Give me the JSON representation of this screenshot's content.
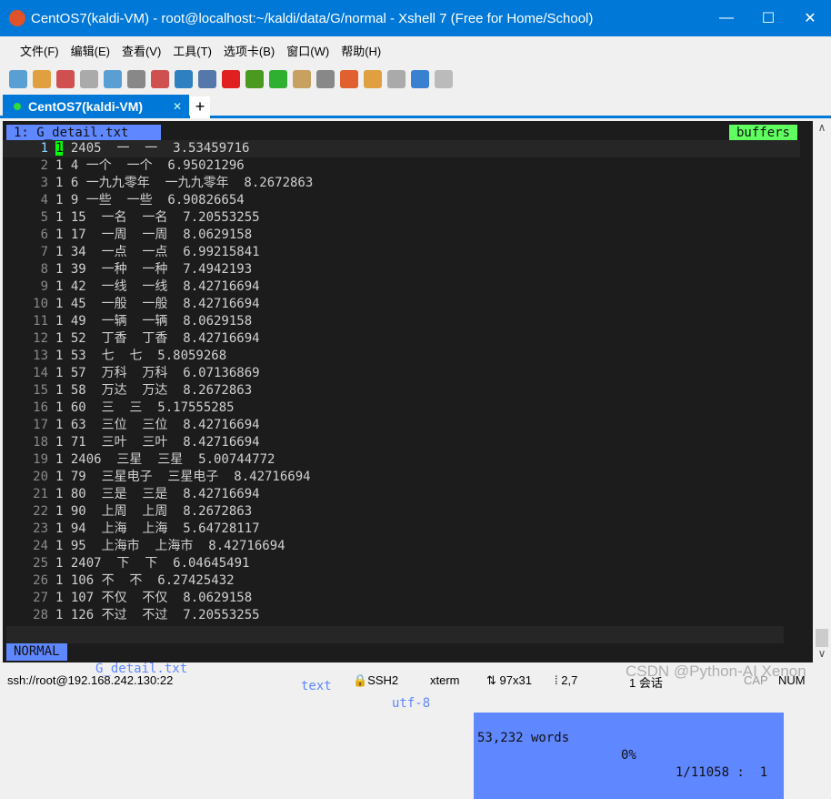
{
  "window": {
    "title": "CentOS7(kaldi-VM) - root@localhost:~/kaldi/data/G/normal - Xshell 7 (Free for Home/School)"
  },
  "menu": [
    "文件(F)",
    "编辑(E)",
    "查看(V)",
    "工具(T)",
    "选项卡(B)",
    "窗口(W)",
    "帮助(H)"
  ],
  "toolbar": [
    "new-session-icon",
    "open-icon",
    "disconnect-icon",
    "reconnect-icon",
    "properties-icon",
    "find-icon",
    "transfer-icon",
    "globe-icon",
    "font-icon",
    "xshell-icon",
    "xftp-icon",
    "fullscreen-icon",
    "lock-icon",
    "keyboard-icon",
    "highlight-icon",
    "new-folder-icon",
    "layout-icon",
    "help-icon",
    "chat-icon"
  ],
  "tab": {
    "label": "CentOS7(kaldi-VM)",
    "add": "+"
  },
  "vim": {
    "buffer": "1: G_detail.txt",
    "buffers": "buffers",
    "lines": [
      [
        "1",
        "1 2405  一  一  3.53459716"
      ],
      [
        "2",
        "1 4 一个  一个  6.95021296"
      ],
      [
        "3",
        "1 6 一九九零年  一九九零年  8.2672863"
      ],
      [
        "4",
        "1 9 一些  一些  6.90826654"
      ],
      [
        "5",
        "1 15  一名  一名  7.20553255"
      ],
      [
        "6",
        "1 17  一周  一周  8.0629158"
      ],
      [
        "7",
        "1 34  一点  一点  6.99215841"
      ],
      [
        "8",
        "1 39  一种  一种  7.4942193"
      ],
      [
        "9",
        "1 42  一线  一线  8.42716694"
      ],
      [
        "10",
        "1 45  一般  一般  8.42716694"
      ],
      [
        "11",
        "1 49  一辆  一辆  8.0629158"
      ],
      [
        "12",
        "1 52  丁香  丁香  8.42716694"
      ],
      [
        "13",
        "1 53  七  七  5.8059268"
      ],
      [
        "14",
        "1 57  万科  万科  6.07136869"
      ],
      [
        "15",
        "1 58  万达  万达  8.2672863"
      ],
      [
        "16",
        "1 60  三  三  5.17555285"
      ],
      [
        "17",
        "1 63  三位  三位  8.42716694"
      ],
      [
        "18",
        "1 71  三叶  三叶  8.42716694"
      ],
      [
        "19",
        "1 2406  三星  三星  5.00744772"
      ],
      [
        "20",
        "1 79  三星电子  三星电子  8.42716694"
      ],
      [
        "21",
        "1 80  三是  三是  8.42716694"
      ],
      [
        "22",
        "1 90  上周  上周  8.2672863"
      ],
      [
        "23",
        "1 94  上海  上海  5.64728117"
      ],
      [
        "24",
        "1 95  上海市  上海市  8.42716694"
      ],
      [
        "25",
        "1 2407  下  下  6.04645491"
      ],
      [
        "26",
        "1 106 不  不  6.27425432"
      ],
      [
        "27",
        "1 107 不仅  不仅  8.0629158"
      ],
      [
        "28",
        "1 126 不过  不过  7.20553255"
      ]
    ],
    "status": {
      "mode": "NORMAL",
      "file": "G_detail.txt",
      "filetype": "text",
      "encoding": "utf-8",
      "words": "53,232 words",
      "percent": "0%",
      "position": "1/11058 :  1"
    }
  },
  "statusbar": {
    "connection": "ssh://root@192.168.242.130:22",
    "protocol": "SSH2",
    "term": "xterm",
    "size": "97x31",
    "cursor": "2,7",
    "sessions": "1 会话",
    "cap": "CAP",
    "num": "NUM"
  },
  "watermark": "CSDN @Python-AI Xenon"
}
